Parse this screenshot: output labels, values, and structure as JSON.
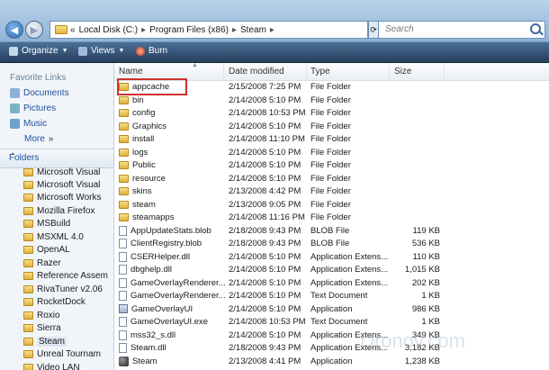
{
  "address": {
    "prefix": "«",
    "crumbs": [
      "Local Disk (C:)",
      "Program Files (x86)",
      "Steam"
    ],
    "search_placeholder": "Search"
  },
  "toolbar": {
    "organize": "Organize",
    "views": "Views",
    "burn": "Burn"
  },
  "nav": {
    "favorites_header": "Favorite Links",
    "favorites": [
      "Documents",
      "Pictures",
      "Music",
      "More"
    ],
    "more_chevron": "»",
    "folders_header": "Folders",
    "tree": [
      "Microsoft Visual",
      "Microsoft Visual",
      "Microsoft Works",
      "Mozilla Firefox",
      "MSBuild",
      "MSXML 4.0",
      "OpenAL",
      "Razer",
      "Reference Assem",
      "RivaTuner v2.06",
      "RocketDock",
      "Roxio",
      "Sierra",
      "Steam",
      "Unreal Tournam",
      "Video LAN"
    ]
  },
  "columns": {
    "name": "Name",
    "date": "Date modified",
    "type": "Type",
    "size": "Size"
  },
  "files": [
    {
      "name": "appcache",
      "date": "2/15/2008 7:25 PM",
      "type": "File Folder",
      "size": "",
      "icon": "folder"
    },
    {
      "name": "bin",
      "date": "2/14/2008 5:10 PM",
      "type": "File Folder",
      "size": "",
      "icon": "folder"
    },
    {
      "name": "config",
      "date": "2/14/2008 10:53 PM",
      "type": "File Folder",
      "size": "",
      "icon": "folder"
    },
    {
      "name": "Graphics",
      "date": "2/14/2008 5:10 PM",
      "type": "File Folder",
      "size": "",
      "icon": "folder"
    },
    {
      "name": "install",
      "date": "2/14/2008 11:10 PM",
      "type": "File Folder",
      "size": "",
      "icon": "folder"
    },
    {
      "name": "logs",
      "date": "2/14/2008 5:10 PM",
      "type": "File Folder",
      "size": "",
      "icon": "folder"
    },
    {
      "name": "Public",
      "date": "2/14/2008 5:10 PM",
      "type": "File Folder",
      "size": "",
      "icon": "folder"
    },
    {
      "name": "resource",
      "date": "2/14/2008 5:10 PM",
      "type": "File Folder",
      "size": "",
      "icon": "folder"
    },
    {
      "name": "skins",
      "date": "2/13/2008 4:42 PM",
      "type": "File Folder",
      "size": "",
      "icon": "folder"
    },
    {
      "name": "steam",
      "date": "2/13/2008 9:05 PM",
      "type": "File Folder",
      "size": "",
      "icon": "folder"
    },
    {
      "name": "steamapps",
      "date": "2/14/2008 11:16 PM",
      "type": "File Folder",
      "size": "",
      "icon": "folder"
    },
    {
      "name": "AppUpdateStats.blob",
      "date": "2/18/2008 9:43 PM",
      "type": "BLOB File",
      "size": "119 KB",
      "icon": "file"
    },
    {
      "name": "ClientRegistry.blob",
      "date": "2/18/2008 9:43 PM",
      "type": "BLOB File",
      "size": "536 KB",
      "icon": "file"
    },
    {
      "name": "CSERHelper.dll",
      "date": "2/14/2008 5:10 PM",
      "type": "Application Extens...",
      "size": "110 KB",
      "icon": "file"
    },
    {
      "name": "dbghelp.dll",
      "date": "2/14/2008 5:10 PM",
      "type": "Application Extens...",
      "size": "1,015 KB",
      "icon": "file"
    },
    {
      "name": "GameOverlayRenderer...",
      "date": "2/14/2008 5:10 PM",
      "type": "Application Extens...",
      "size": "202 KB",
      "icon": "file"
    },
    {
      "name": "GameOverlayRenderer...",
      "date": "2/14/2008 5:10 PM",
      "type": "Text Document",
      "size": "1 KB",
      "icon": "file"
    },
    {
      "name": "GameOverlayUI",
      "date": "2/14/2008 5:10 PM",
      "type": "Application",
      "size": "986 KB",
      "icon": "app"
    },
    {
      "name": "GameOverlayUI.exe",
      "date": "2/14/2008 10:53 PM",
      "type": "Text Document",
      "size": "1 KB",
      "icon": "file"
    },
    {
      "name": "mss32_s.dll",
      "date": "2/14/2008 5:10 PM",
      "type": "Application Extens...",
      "size": "349 KB",
      "icon": "file"
    },
    {
      "name": "Steam.dll",
      "date": "2/18/2008 9:43 PM",
      "type": "Application Extens...",
      "size": "3,182 KB",
      "icon": "file"
    },
    {
      "name": "Steam",
      "date": "2/13/2008 4:41 PM",
      "type": "Application",
      "size": "1,238 KB",
      "icon": "steam"
    }
  ],
  "watermark": "Dronov.com"
}
